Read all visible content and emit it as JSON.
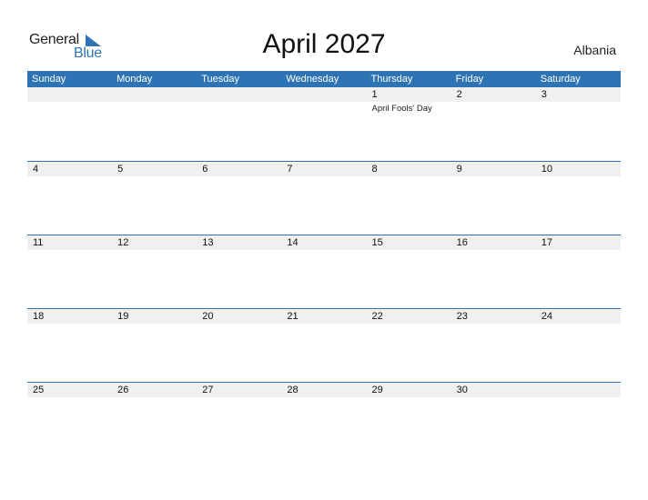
{
  "logo": {
    "word1": "General",
    "word2": "Blue"
  },
  "title": "April 2027",
  "country": "Albania",
  "colors": {
    "accent": "#2e74b5",
    "strip": "#f0f0f0"
  },
  "weekdays": [
    "Sunday",
    "Monday",
    "Tuesday",
    "Wednesday",
    "Thursday",
    "Friday",
    "Saturday"
  ],
  "weeks": [
    {
      "days": [
        "",
        "",
        "",
        "",
        "1",
        "2",
        "3"
      ],
      "events": [
        "",
        "",
        "",
        "",
        "April Fools' Day",
        "",
        ""
      ]
    },
    {
      "days": [
        "4",
        "5",
        "6",
        "7",
        "8",
        "9",
        "10"
      ],
      "events": [
        "",
        "",
        "",
        "",
        "",
        "",
        ""
      ]
    },
    {
      "days": [
        "11",
        "12",
        "13",
        "14",
        "15",
        "16",
        "17"
      ],
      "events": [
        "",
        "",
        "",
        "",
        "",
        "",
        ""
      ]
    },
    {
      "days": [
        "18",
        "19",
        "20",
        "21",
        "22",
        "23",
        "24"
      ],
      "events": [
        "",
        "",
        "",
        "",
        "",
        "",
        ""
      ]
    },
    {
      "days": [
        "25",
        "26",
        "27",
        "28",
        "29",
        "30",
        ""
      ],
      "events": [
        "",
        "",
        "",
        "",
        "",
        "",
        ""
      ]
    }
  ]
}
